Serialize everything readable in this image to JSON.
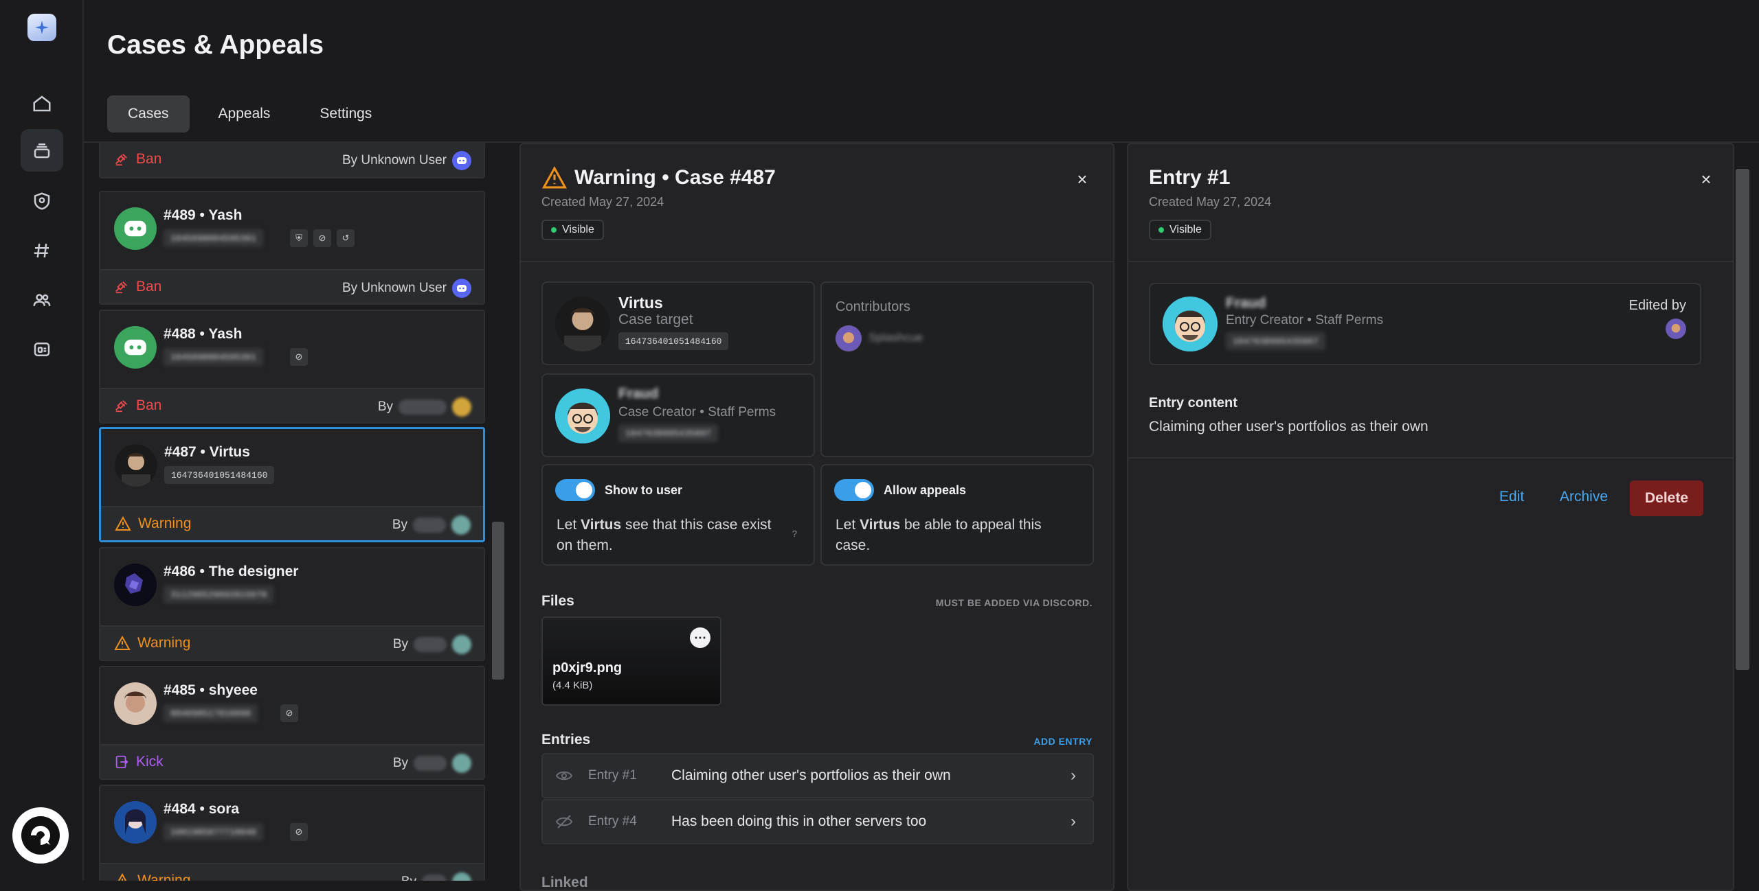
{
  "page": {
    "title": "Cases & Appeals"
  },
  "tabs": [
    {
      "label": "Cases",
      "active": true
    },
    {
      "label": "Appeals",
      "active": false
    },
    {
      "label": "Settings",
      "active": false
    }
  ],
  "rail": {
    "icons": [
      "home-icon",
      "stack-icon",
      "shield-user-icon",
      "hash-icon",
      "users-icon",
      "card-icon"
    ]
  },
  "cases": [
    {
      "name": "",
      "id": "",
      "action": "Ban",
      "action_kind": "ban",
      "by": "By Unknown User"
    },
    {
      "name": "#489 • Yash",
      "id": "1045698004595361",
      "action": "Ban",
      "action_kind": "ban",
      "by": "By Unknown User"
    },
    {
      "name": "#488 • Yash",
      "id": "1045698004595361",
      "action": "Ban",
      "action_kind": "ban",
      "by": "By"
    },
    {
      "name": "#487 • Virtus",
      "id": "164736401051484160",
      "action": "Warning",
      "action_kind": "warn",
      "by": "By"
    },
    {
      "name": "#486 • The designer",
      "id": "311296529692815070",
      "action": "Warning",
      "action_kind": "warn",
      "by": "By"
    },
    {
      "name": "#485 • shyeee",
      "id": "804698517816690",
      "action": "Kick",
      "action_kind": "kick",
      "by": "By"
    },
    {
      "name": "#484 • sora",
      "id": "1001985877710040",
      "action": "Warning",
      "action_kind": "warn",
      "by": "By"
    }
  ],
  "case_panel": {
    "title": "Warning • Case #487",
    "created": "Created May 27, 2024",
    "visibility": "Visible",
    "target": {
      "name": "Virtus",
      "role": "Case target",
      "id": "164736401051484160"
    },
    "creator": {
      "name": "Fraud",
      "role": "Case Creator • Staff Perms",
      "id": "1047638995435807"
    },
    "contributors_label": "Contributors",
    "contributor_name": "Splashcue",
    "show_to_user": {
      "label": "Show to user",
      "text_prefix": "Let ",
      "text_name": "Virtus",
      "text_suffix": " see that this case exist on them.",
      "help": "?"
    },
    "allow_appeals": {
      "label": "Allow appeals",
      "text_prefix": "Let ",
      "text_name": "Virtus",
      "text_suffix": " be able to appeal this case."
    },
    "files_label": "Files",
    "files_note": "MUST BE ADDED VIA DISCORD.",
    "file": {
      "name": "p0xjr9.png",
      "size": "(4.4 KiB)"
    },
    "entries_label": "Entries",
    "add_entry": "ADD ENTRY",
    "entries": [
      {
        "name": "Entry #1",
        "text": "Claiming other user's portfolios as their own"
      },
      {
        "name": "Entry #4",
        "text": "Has been doing this in other servers too"
      }
    ],
    "cutoff_label": "Linked "
  },
  "entry_panel": {
    "title": "Entry #1",
    "created": "Created May 27, 2024",
    "visibility": "Visible",
    "creator": {
      "name": "Fraud",
      "role": "Entry Creator • Staff Perms",
      "id": "1047638995435807"
    },
    "edited_by": "Edited by",
    "content_label": "Entry content",
    "content": "Claiming other user's portfolios as their own",
    "edit": "Edit",
    "archive": "Archive",
    "delete": "Delete"
  },
  "colors": {
    "accent": "#3b9ee8",
    "ban": "#ef4b4b",
    "warning": "#f0901e",
    "kick": "#b05cf0",
    "danger_bg": "#7a1d1d"
  }
}
